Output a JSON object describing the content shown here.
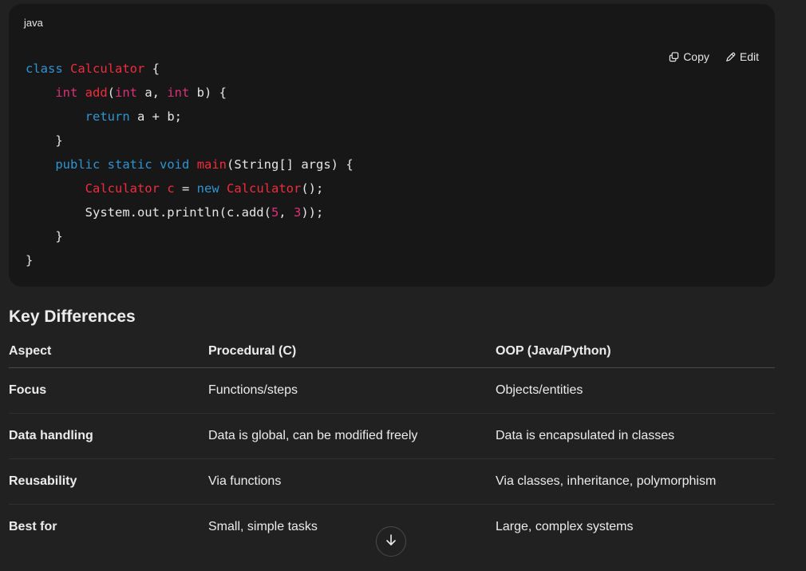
{
  "code_block": {
    "language": "java",
    "copy_label": "Copy",
    "edit_label": "Edit",
    "lines": [
      [
        {
          "t": "class ",
          "c": "kw"
        },
        {
          "t": "Calculator",
          "c": "ty"
        },
        {
          "t": " {",
          "c": "pl"
        }
      ],
      [
        {
          "t": "    ",
          "c": "pl"
        },
        {
          "t": "int",
          "c": "fn"
        },
        {
          "t": " ",
          "c": "pl"
        },
        {
          "t": "add",
          "c": "ty"
        },
        {
          "t": "(",
          "c": "pl"
        },
        {
          "t": "int",
          "c": "fn"
        },
        {
          "t": " a, ",
          "c": "pl"
        },
        {
          "t": "int",
          "c": "fn"
        },
        {
          "t": " b) {",
          "c": "pl"
        }
      ],
      [
        {
          "t": "        ",
          "c": "pl"
        },
        {
          "t": "return",
          "c": "kw"
        },
        {
          "t": " a + b;",
          "c": "pl"
        }
      ],
      [
        {
          "t": "    }",
          "c": "pl"
        }
      ],
      [
        {
          "t": "    ",
          "c": "pl"
        },
        {
          "t": "public",
          "c": "kw"
        },
        {
          "t": " ",
          "c": "pl"
        },
        {
          "t": "static",
          "c": "kw"
        },
        {
          "t": " ",
          "c": "pl"
        },
        {
          "t": "void",
          "c": "kw"
        },
        {
          "t": " ",
          "c": "pl"
        },
        {
          "t": "main",
          "c": "ty"
        },
        {
          "t": "(String[] args) {",
          "c": "pl"
        }
      ],
      [
        {
          "t": "        ",
          "c": "pl"
        },
        {
          "t": "Calculator",
          "c": "ty"
        },
        {
          "t": " ",
          "c": "pl"
        },
        {
          "t": "c",
          "c": "ty"
        },
        {
          "t": " = ",
          "c": "pl"
        },
        {
          "t": "new",
          "c": "kw"
        },
        {
          "t": " ",
          "c": "pl"
        },
        {
          "t": "Calculator",
          "c": "ty"
        },
        {
          "t": "();",
          "c": "pl"
        }
      ],
      [
        {
          "t": "        System.out.println(c.add(",
          "c": "pl"
        },
        {
          "t": "5",
          "c": "nu"
        },
        {
          "t": ", ",
          "c": "pl"
        },
        {
          "t": "3",
          "c": "nu"
        },
        {
          "t": "));",
          "c": "pl"
        }
      ],
      [
        {
          "t": "    }",
          "c": "pl"
        }
      ],
      [
        {
          "t": "}",
          "c": "pl"
        }
      ]
    ]
  },
  "section_heading": "Key Differences",
  "table": {
    "headers": [
      "Aspect",
      "Procedural (C)",
      "OOP (Java/Python)"
    ],
    "rows": [
      [
        "Focus",
        "Functions/steps",
        "Objects/entities"
      ],
      [
        "Data handling",
        "Data is global, can be modified freely",
        "Data is encapsulated in classes"
      ],
      [
        "Reusability",
        "Via functions",
        "Via classes, inheritance, polymorphism"
      ],
      [
        "Best for",
        "Small, simple tasks",
        "Large, complex systems"
      ]
    ]
  },
  "icons": {
    "copy": "copy-icon",
    "edit": "edit-icon",
    "scroll_down": "arrow-down-icon"
  }
}
